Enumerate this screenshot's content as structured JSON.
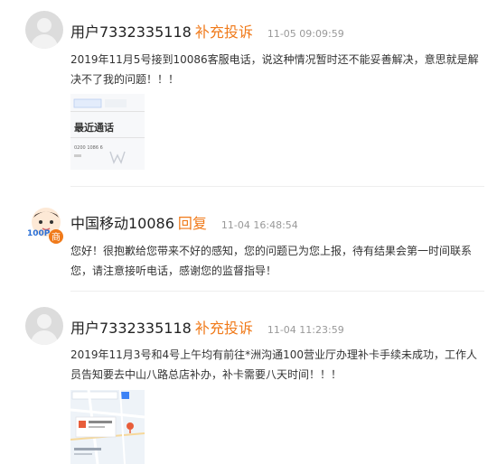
{
  "entries": [
    {
      "user": "用户7332335118",
      "tag": "补充投诉",
      "time": "11-05 09:09:59",
      "text": "2019年11月5号接到10086客服电话，说这种情况暂时还不能妥善解决，意思就是解决不了我的问题！！！",
      "thumbnail": {
        "title": "最近通话",
        "number": "0200 1086 6"
      }
    },
    {
      "user": "中国移动10086",
      "tag": "回复",
      "time": "11-04 16:48:54",
      "text": "您好！很抱歉给您带来不好的感知，您的问题已为您上报，待有结果会第一时间联系您，请注意接听电话，感谢您的监督指导！",
      "avatar_badge": "100P",
      "avatar_mark": "商"
    },
    {
      "user": "用户7332335118",
      "tag": "补充投诉",
      "time": "11-04 11:23:59",
      "text": "2019年11月3号和4号上午均有前往*洲沟通100营业厅办理补卡手续未成功，工作人员告知要去中山八路总店补办，补卡需要八天时间！！！"
    }
  ],
  "colors": {
    "tag": "#f07a1a",
    "time": "#999999",
    "avatar_placeholder": "#dcdcdc",
    "brand_badge": "#2a6fd6",
    "brand_mark": "#f07a1a"
  }
}
